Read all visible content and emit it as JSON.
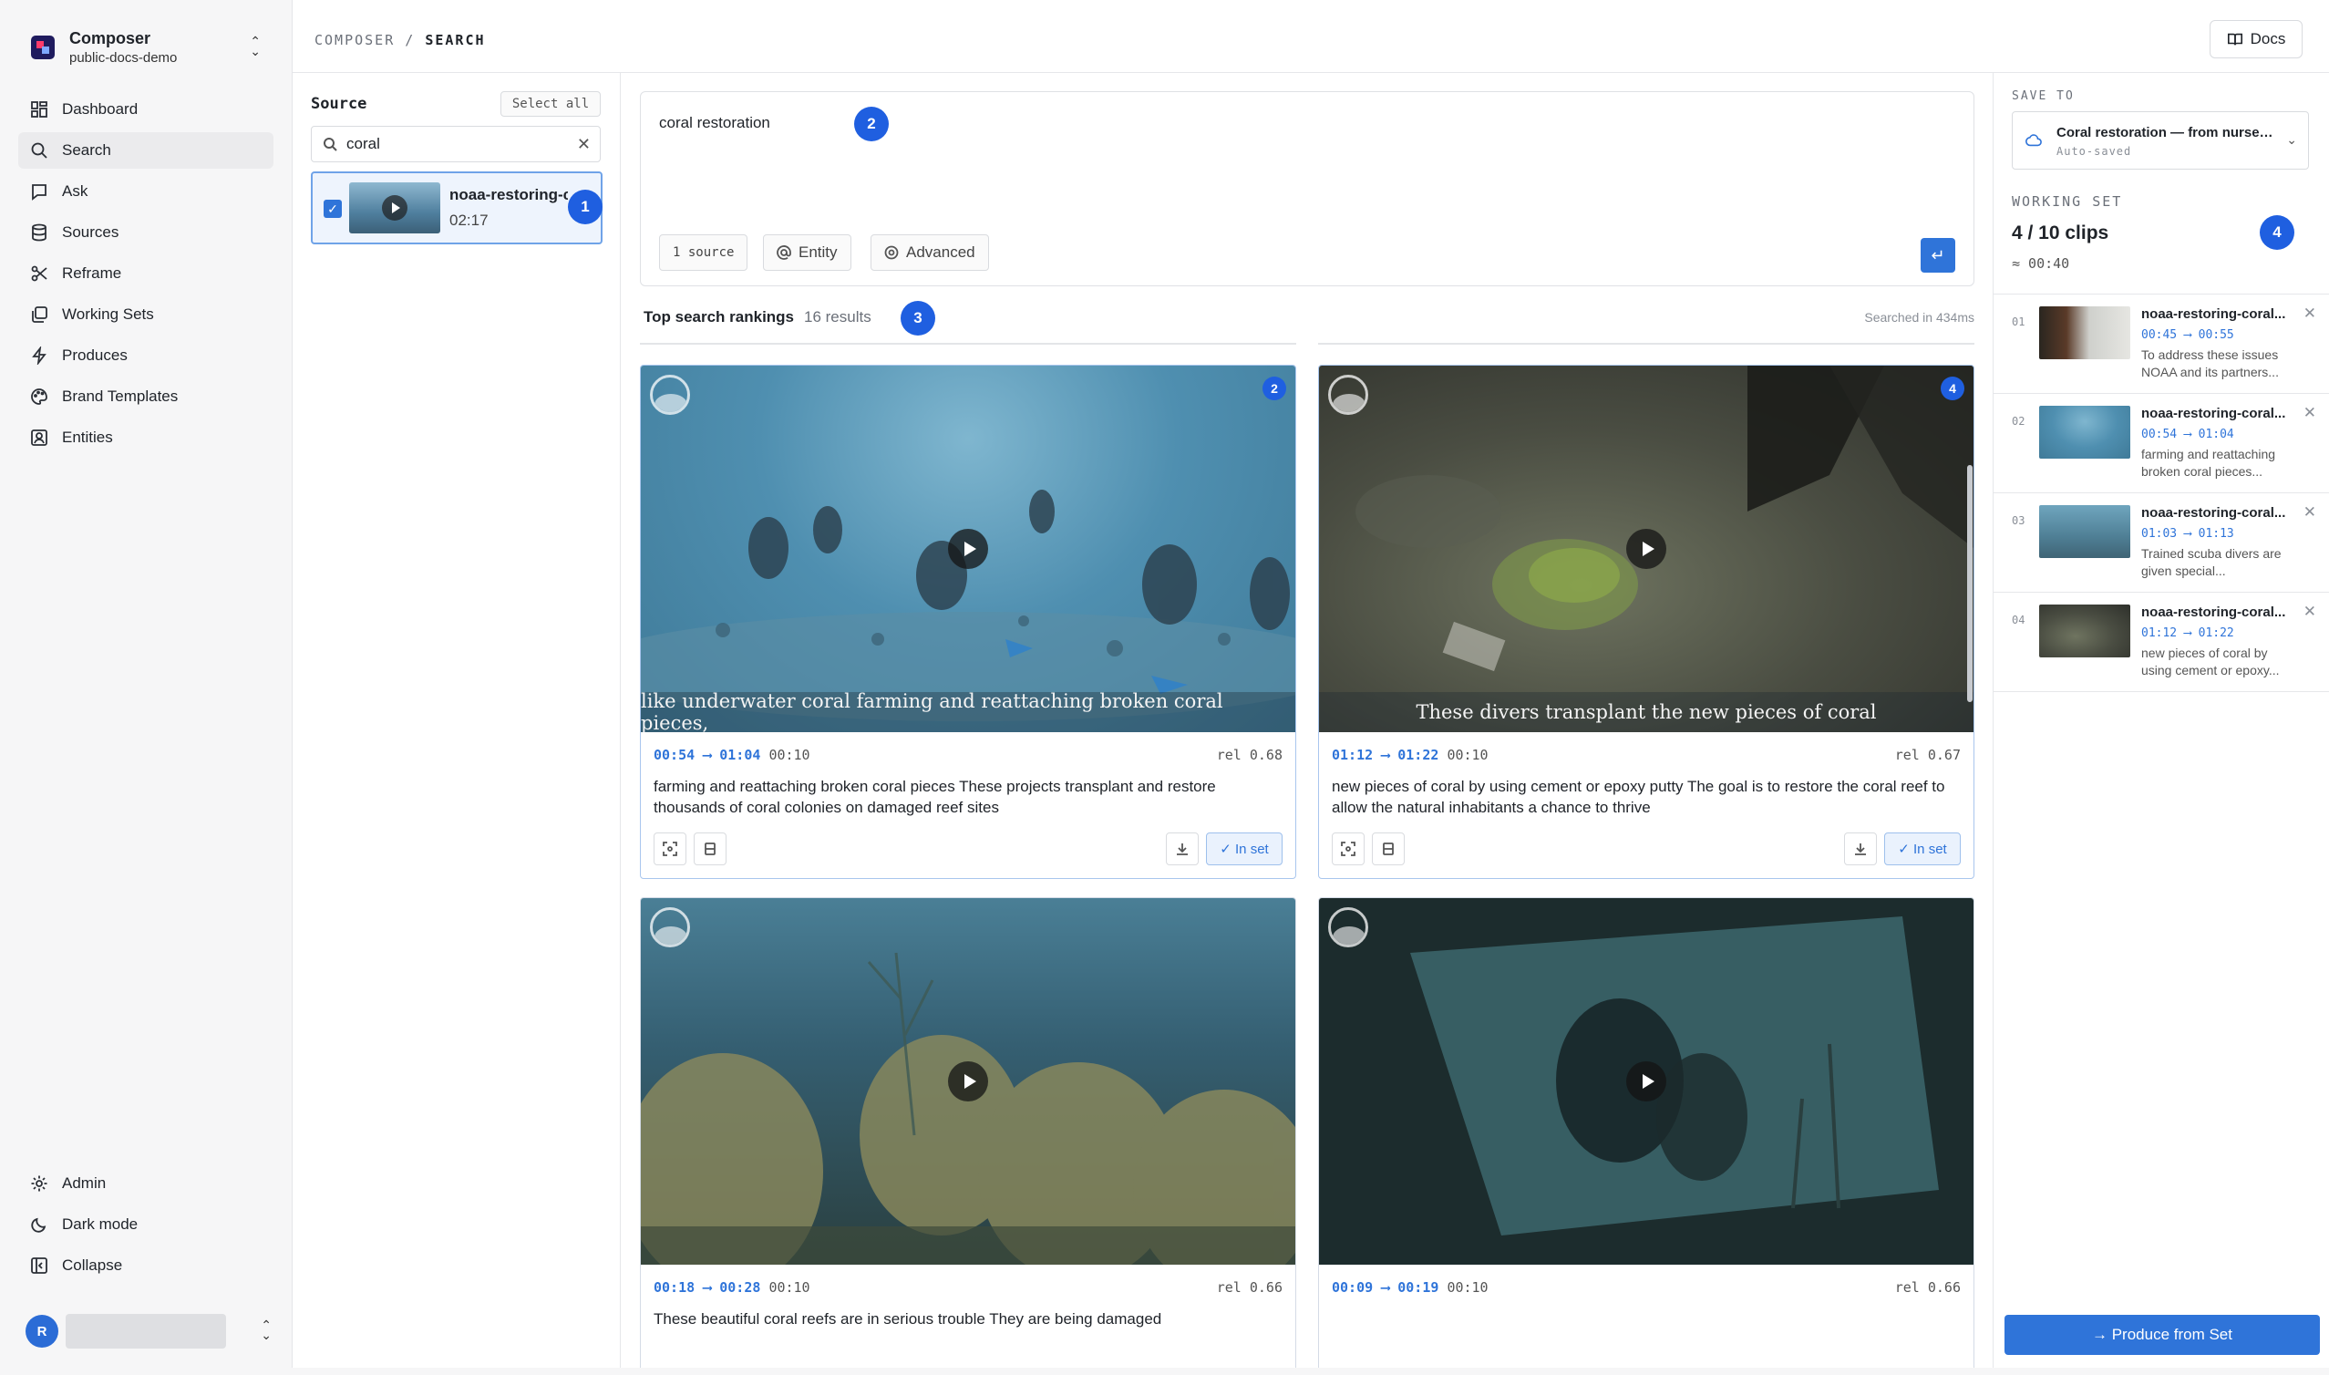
{
  "workspace": {
    "name": "Composer",
    "org": "public-docs-demo"
  },
  "nav": {
    "items": [
      {
        "label": "Dashboard",
        "icon": "grid-icon"
      },
      {
        "label": "Search",
        "icon": "search-icon",
        "active": true
      },
      {
        "label": "Ask",
        "icon": "chat-icon"
      },
      {
        "label": "Sources",
        "icon": "database-icon"
      },
      {
        "label": "Reframe",
        "icon": "scissors-icon"
      },
      {
        "label": "Working Sets",
        "icon": "layers-icon"
      },
      {
        "label": "Produces",
        "icon": "bolt-icon"
      },
      {
        "label": "Brand Templates",
        "icon": "palette-icon"
      },
      {
        "label": "Entities",
        "icon": "contact-icon"
      }
    ],
    "bottom": [
      {
        "label": "Admin",
        "icon": "gear-icon"
      },
      {
        "label": "Dark mode",
        "icon": "moon-icon"
      },
      {
        "label": "Collapse",
        "icon": "collapse-icon"
      }
    ]
  },
  "user": {
    "initial": "R"
  },
  "breadcrumb": {
    "root": "COMPOSER",
    "sep": "/",
    "current": "SEARCH"
  },
  "header": {
    "docs_label": "Docs"
  },
  "source_panel": {
    "title": "Source",
    "select_all": "Select all",
    "search_value": "coral",
    "item": {
      "name": "noaa-restoring-c",
      "duration": "02:17"
    }
  },
  "badges": {
    "b1": "1",
    "b2": "2",
    "b3": "3",
    "b4": "4"
  },
  "query": {
    "text": "coral restoration",
    "chip_source": "1 source",
    "chip_entity": "Entity",
    "chip_advanced": "Advanced",
    "enter_glyph": "↵"
  },
  "results": {
    "title": "Top search rankings",
    "count": "16 results",
    "searched": "Searched in 434ms",
    "cards": [
      {
        "rank": "2",
        "start": "00:54",
        "arrow": "⟶",
        "end": "01:04",
        "dur": "00:10",
        "rel": "rel 0.68",
        "caption": "like underwater coral farming and reattaching broken coral pieces,",
        "text": "farming and reattaching broken coral pieces These projects transplant and restore thousands of coral colonies on damaged reef sites",
        "in_set": "✓ In set"
      },
      {
        "rank": "4",
        "start": "01:12",
        "arrow": "⟶",
        "end": "01:22",
        "dur": "00:10",
        "rel": "rel 0.67",
        "caption": "These divers transplant the new pieces of coral",
        "text": "new pieces of coral by using cement or epoxy putty The goal is to restore the coral reef to allow the natural inhabitants a chance to thrive",
        "in_set": "✓ In set"
      },
      {
        "start": "00:18",
        "arrow": "⟶",
        "end": "00:28",
        "dur": "00:10",
        "rel": "rel 0.66",
        "text": "These beautiful coral reefs are in serious trouble They are being damaged"
      },
      {
        "start": "00:09",
        "arrow": "⟶",
        "end": "00:19",
        "dur": "00:10",
        "rel": "rel 0.66",
        "text": ""
      }
    ]
  },
  "right_panel": {
    "save_to_label": "SAVE TO",
    "save_name": "Coral restoration — from nurser...",
    "save_status": "Auto-saved",
    "working_set_label": "WORKING SET",
    "working_set_count": "4 / 10 clips",
    "working_set_duration": "≈ 00:40",
    "clips": [
      {
        "idx": "01",
        "name": "noaa-restoring-coral...",
        "tc": "00:45 ⟶ 00:55",
        "desc": "To address these issues NOAA and its partners..."
      },
      {
        "idx": "02",
        "name": "noaa-restoring-coral...",
        "tc": "00:54 ⟶ 01:04",
        "desc": "farming and reattaching broken coral pieces..."
      },
      {
        "idx": "03",
        "name": "noaa-restoring-coral...",
        "tc": "01:03 ⟶ 01:13",
        "desc": "Trained scuba divers are given special..."
      },
      {
        "idx": "04",
        "name": "noaa-restoring-coral...",
        "tc": "01:12 ⟶ 01:22",
        "desc": "new pieces of coral by using cement or epoxy..."
      }
    ],
    "produce_label": "→ Produce from Set"
  }
}
